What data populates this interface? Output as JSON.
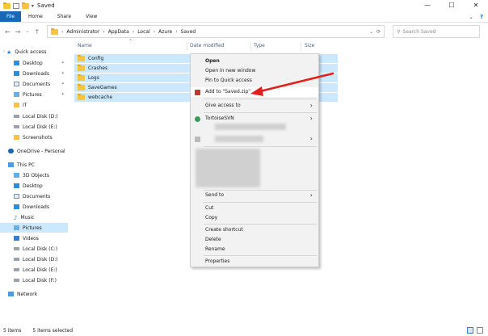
{
  "window": {
    "title": "Saved"
  },
  "ribbon": {
    "tabs": [
      "File",
      "Home",
      "Share",
      "View"
    ]
  },
  "address": {
    "segments": [
      "Administrator",
      "AppData",
      "Local",
      "Azure",
      "Saved"
    ],
    "search_placeholder": "Search Saved"
  },
  "sidebar": {
    "quick_access": "Quick access",
    "quick_items": [
      "Desktop",
      "Downloads",
      "Documents",
      "Pictures",
      "IT",
      "Local Disk (D:)",
      "Local Disk (E:)",
      "Screenshots"
    ],
    "onedrive": "OneDrive - Personal",
    "this_pc": "This PC",
    "pc_items": [
      "3D Objects",
      "Desktop",
      "Documents",
      "Downloads",
      "Music",
      "Pictures",
      "Videos",
      "Local Disk (C:)",
      "Local Disk (D:)",
      "Local Disk (E:)",
      "Local Disk (F:)"
    ],
    "network": "Network"
  },
  "columns": [
    "Name",
    "Date modified",
    "Type",
    "Size"
  ],
  "files": [
    "Config",
    "Crashes",
    "Logs",
    "SaveGames",
    "webcache"
  ],
  "context_menu": {
    "open": "Open",
    "open_new_window": "Open in new window",
    "pin_quick_access": "Pin to Quick access",
    "add_to_zip": "Add to \"Saved.zip\"",
    "give_access": "Give access to",
    "tortoise": "TortoiseSVN",
    "send_to": "Send to",
    "cut": "Cut",
    "copy": "Copy",
    "create_shortcut": "Create shortcut",
    "delete": "Delete",
    "rename": "Rename",
    "properties": "Properties"
  },
  "status": {
    "items": "5 items",
    "selected": "5 items selected"
  },
  "colors": {
    "selection": "#cce8ff",
    "accent": "#1a67b4",
    "annotation": "#e0201c",
    "folder": "#f5c542"
  }
}
